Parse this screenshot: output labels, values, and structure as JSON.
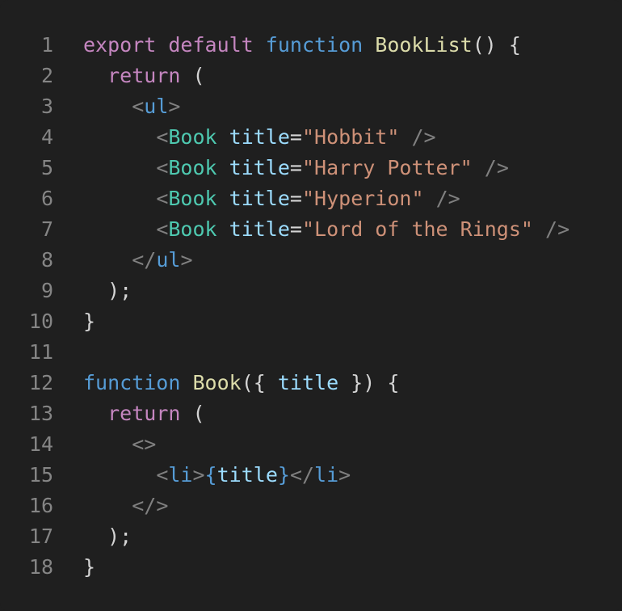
{
  "colors": {
    "background": "#1f1f1f",
    "line_number": "#858585",
    "keyword": "#c586c0",
    "function_keyword": "#569cd6",
    "function_name": "#dcdcaa",
    "component_tag": "#4ec9b0",
    "html_tag": "#569cd6",
    "attribute": "#9cdcfe",
    "string": "#ce9178",
    "jsx_bracket": "#808080",
    "plain": "#d4d4d4"
  },
  "lines": [
    {
      "n": "1",
      "tokens": [
        {
          "t": "export",
          "c": "t-kw"
        },
        {
          "t": " ",
          "c": "t-plain"
        },
        {
          "t": "default",
          "c": "t-kw"
        },
        {
          "t": " ",
          "c": "t-plain"
        },
        {
          "t": "function",
          "c": "t-fn"
        },
        {
          "t": " ",
          "c": "t-plain"
        },
        {
          "t": "BookList",
          "c": "t-name"
        },
        {
          "t": "() {",
          "c": "t-plain"
        }
      ]
    },
    {
      "n": "2",
      "tokens": [
        {
          "t": "  ",
          "c": "t-plain"
        },
        {
          "t": "return",
          "c": "t-kw"
        },
        {
          "t": " (",
          "c": "t-plain"
        }
      ]
    },
    {
      "n": "3",
      "tokens": [
        {
          "t": "    ",
          "c": "t-plain"
        },
        {
          "t": "<",
          "c": "t-punc"
        },
        {
          "t": "ul",
          "c": "t-htag"
        },
        {
          "t": ">",
          "c": "t-punc"
        }
      ]
    },
    {
      "n": "4",
      "tokens": [
        {
          "t": "      ",
          "c": "t-plain"
        },
        {
          "t": "<",
          "c": "t-punc"
        },
        {
          "t": "Book",
          "c": "t-tag"
        },
        {
          "t": " ",
          "c": "t-plain"
        },
        {
          "t": "title",
          "c": "t-attr"
        },
        {
          "t": "=",
          "c": "t-plain"
        },
        {
          "t": "\"Hobbit\"",
          "c": "t-str"
        },
        {
          "t": " ",
          "c": "t-plain"
        },
        {
          "t": "/>",
          "c": "t-punc"
        }
      ]
    },
    {
      "n": "5",
      "tokens": [
        {
          "t": "      ",
          "c": "t-plain"
        },
        {
          "t": "<",
          "c": "t-punc"
        },
        {
          "t": "Book",
          "c": "t-tag"
        },
        {
          "t": " ",
          "c": "t-plain"
        },
        {
          "t": "title",
          "c": "t-attr"
        },
        {
          "t": "=",
          "c": "t-plain"
        },
        {
          "t": "\"Harry Potter\"",
          "c": "t-str"
        },
        {
          "t": " ",
          "c": "t-plain"
        },
        {
          "t": "/>",
          "c": "t-punc"
        }
      ]
    },
    {
      "n": "6",
      "tokens": [
        {
          "t": "      ",
          "c": "t-plain"
        },
        {
          "t": "<",
          "c": "t-punc"
        },
        {
          "t": "Book",
          "c": "t-tag"
        },
        {
          "t": " ",
          "c": "t-plain"
        },
        {
          "t": "title",
          "c": "t-attr"
        },
        {
          "t": "=",
          "c": "t-plain"
        },
        {
          "t": "\"Hyperion\"",
          "c": "t-str"
        },
        {
          "t": " ",
          "c": "t-plain"
        },
        {
          "t": "/>",
          "c": "t-punc"
        }
      ]
    },
    {
      "n": "7",
      "tokens": [
        {
          "t": "      ",
          "c": "t-plain"
        },
        {
          "t": "<",
          "c": "t-punc"
        },
        {
          "t": "Book",
          "c": "t-tag"
        },
        {
          "t": " ",
          "c": "t-plain"
        },
        {
          "t": "title",
          "c": "t-attr"
        },
        {
          "t": "=",
          "c": "t-plain"
        },
        {
          "t": "\"Lord of the Rings\"",
          "c": "t-str"
        },
        {
          "t": " ",
          "c": "t-plain"
        },
        {
          "t": "/>",
          "c": "t-punc"
        }
      ]
    },
    {
      "n": "8",
      "tokens": [
        {
          "t": "    ",
          "c": "t-plain"
        },
        {
          "t": "</",
          "c": "t-punc"
        },
        {
          "t": "ul",
          "c": "t-htag"
        },
        {
          "t": ">",
          "c": "t-punc"
        }
      ]
    },
    {
      "n": "9",
      "tokens": [
        {
          "t": "  );",
          "c": "t-plain"
        }
      ]
    },
    {
      "n": "10",
      "tokens": [
        {
          "t": "}",
          "c": "t-plain"
        }
      ]
    },
    {
      "n": "11",
      "tokens": []
    },
    {
      "n": "12",
      "tokens": [
        {
          "t": "function",
          "c": "t-fn"
        },
        {
          "t": " ",
          "c": "t-plain"
        },
        {
          "t": "Book",
          "c": "t-name"
        },
        {
          "t": "({ ",
          "c": "t-plain"
        },
        {
          "t": "title",
          "c": "t-attr"
        },
        {
          "t": " }) {",
          "c": "t-plain"
        }
      ]
    },
    {
      "n": "13",
      "tokens": [
        {
          "t": "  ",
          "c": "t-plain"
        },
        {
          "t": "return",
          "c": "t-kw"
        },
        {
          "t": " (",
          "c": "t-plain"
        }
      ]
    },
    {
      "n": "14",
      "tokens": [
        {
          "t": "    ",
          "c": "t-plain"
        },
        {
          "t": "<>",
          "c": "t-punc"
        }
      ]
    },
    {
      "n": "15",
      "tokens": [
        {
          "t": "      ",
          "c": "t-plain"
        },
        {
          "t": "<",
          "c": "t-punc"
        },
        {
          "t": "li",
          "c": "t-htag"
        },
        {
          "t": ">",
          "c": "t-punc"
        },
        {
          "t": "{",
          "c": "t-brace"
        },
        {
          "t": "title",
          "c": "t-attr"
        },
        {
          "t": "}",
          "c": "t-brace"
        },
        {
          "t": "</",
          "c": "t-punc"
        },
        {
          "t": "li",
          "c": "t-htag"
        },
        {
          "t": ">",
          "c": "t-punc"
        }
      ]
    },
    {
      "n": "16",
      "tokens": [
        {
          "t": "    ",
          "c": "t-plain"
        },
        {
          "t": "</>",
          "c": "t-punc"
        }
      ]
    },
    {
      "n": "17",
      "tokens": [
        {
          "t": "  );",
          "c": "t-plain"
        }
      ]
    },
    {
      "n": "18",
      "tokens": [
        {
          "t": "}",
          "c": "t-plain"
        }
      ]
    }
  ]
}
